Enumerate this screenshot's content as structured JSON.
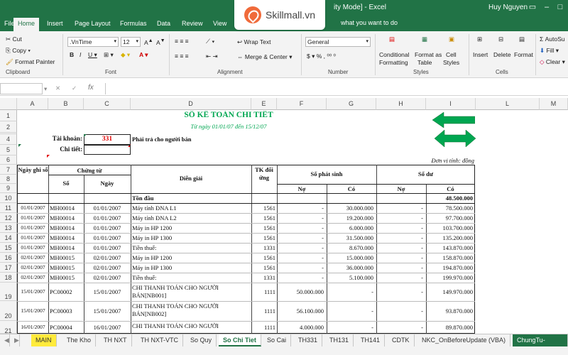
{
  "titlebar": {
    "doc_title": "ity Mode]  -  Excel",
    "user": "Huy Nguyen",
    "logo_text": "Skillmall.vn"
  },
  "tabs": [
    {
      "label": "File"
    },
    {
      "label": "Home"
    },
    {
      "label": "Insert"
    },
    {
      "label": "Page Layout"
    },
    {
      "label": "Formulas"
    },
    {
      "label": "Data"
    },
    {
      "label": "Review"
    },
    {
      "label": "View"
    }
  ],
  "tell_me": "what you want to do",
  "ribbon": {
    "clipboard": {
      "cut": "Cut",
      "copy": "Copy",
      "format_painter": "Format Painter",
      "label": "Clipboard"
    },
    "font": {
      "name": ".VnTime",
      "size": "12",
      "label": "Font"
    },
    "alignment": {
      "wrap": "Wrap Text",
      "merge": "Merge & Center",
      "label": "Alignment"
    },
    "number": {
      "format": "General",
      "label": "Number"
    },
    "styles": {
      "cond1": "Conditional",
      "cond2": "Formatting",
      "fmt1": "Format as",
      "fmt2": "Table",
      "cell1": "Cell",
      "cell2": "Styles",
      "label": "Styles"
    },
    "cells": {
      "insert": "Insert",
      "delete": "Delete",
      "format": "Format",
      "label": "Cells"
    },
    "editing": {
      "autosum": "AutoSu",
      "fill": "Fill",
      "clear": "Clear"
    }
  },
  "formula_bar": {
    "fx": "fx",
    "value": ""
  },
  "columns": [
    "A",
    "B",
    "C",
    "D",
    "E",
    "F",
    "G",
    "H",
    "I",
    "L",
    "M"
  ],
  "rows": [
    "1",
    "2",
    "3",
    "4",
    "5",
    "6",
    "7",
    "8",
    "9",
    "10",
    "11",
    "12",
    "13",
    "14",
    "15",
    "16",
    "17",
    "18",
    "19",
    "20",
    "21"
  ],
  "sheet": {
    "title": "SỔ KẾ TOÁN CHI TIẾT",
    "subtitle": "Từ ngày 01/01/07 đến 15/12/07",
    "account_label": "Tài khoản:",
    "account_value": "331",
    "account_desc": "Phải trả cho người bán",
    "detail_label": "Chi tiết:",
    "unit": "Đơn vị tính: đồng",
    "headers": {
      "date": "Ngày ghi sổ",
      "voucher": "Chứng từ",
      "no": "Số",
      "day": "Ngày",
      "desc": "Diễn giải",
      "tk": "TK đối ứng",
      "so_phat_sinh": "Số phát sinh",
      "so_du": "Số dư",
      "no_debit": "Nợ",
      "co_credit": "Có"
    },
    "opening": {
      "desc": "Tồn đầu",
      "balance": "48.500.000"
    },
    "rows": [
      {
        "row": "11",
        "date": "01/01/2007",
        "no": "MH00014",
        "day": "01/01/2007",
        "desc": "Máy tính ĐNA L1",
        "tk": "1561",
        "debit": "-",
        "credit": "30.000.000",
        "bal_debit": "-",
        "bal_credit": "78.500.000"
      },
      {
        "row": "12",
        "date": "01/01/2007",
        "no": "MH00014",
        "day": "01/01/2007",
        "desc": "Máy tính ĐNA L2",
        "tk": "1561",
        "debit": "-",
        "credit": "19.200.000",
        "bal_debit": "-",
        "bal_credit": "97.700.000"
      },
      {
        "row": "13",
        "date": "01/01/2007",
        "no": "MH00014",
        "day": "01/01/2007",
        "desc": "Máy in HP 1200",
        "tk": "1561",
        "debit": "-",
        "credit": "6.000.000",
        "bal_debit": "-",
        "bal_credit": "103.700.000"
      },
      {
        "row": "14",
        "date": "01/01/2007",
        "no": "MH00014",
        "day": "01/01/2007",
        "desc": "Máy in HP 1300",
        "tk": "1561",
        "debit": "-",
        "credit": "31.500.000",
        "bal_debit": "-",
        "bal_credit": "135.200.000"
      },
      {
        "row": "15",
        "date": "01/01/2007",
        "no": "MH00014",
        "day": "01/01/2007",
        "desc": "Tiền thuế:",
        "tk": "1331",
        "debit": "-",
        "credit": "8.670.000",
        "bal_debit": "-",
        "bal_credit": "143.870.000"
      },
      {
        "row": "16",
        "date": "02/01/2007",
        "no": "MH00015",
        "day": "02/01/2007",
        "desc": "Máy in HP 1200",
        "tk": "1561",
        "debit": "-",
        "credit": "15.000.000",
        "bal_debit": "-",
        "bal_credit": "158.870.000"
      },
      {
        "row": "17",
        "date": "02/01/2007",
        "no": "MH00015",
        "day": "02/01/2007",
        "desc": "Máy in HP 1300",
        "tk": "1561",
        "debit": "-",
        "credit": "36.000.000",
        "bal_debit": "-",
        "bal_credit": "194.870.000"
      },
      {
        "row": "18",
        "date": "02/01/2007",
        "no": "MH00015",
        "day": "02/01/2007",
        "desc": "Tiền thuế:",
        "tk": "1331",
        "debit": "-",
        "credit": "5.100.000",
        "bal_debit": "-",
        "bal_credit": "199.970.000"
      },
      {
        "row": "19",
        "date": "15/01/2007",
        "no": "PC00002",
        "day": "15/01/2007",
        "desc": "CHI THANH TOÁN CHO NGƯỜI",
        "desc2": "BÁN[NB001]",
        "tk": "1111",
        "debit": "50.000.000",
        "credit": "-",
        "bal_debit": "-",
        "bal_credit": "149.970.000"
      },
      {
        "row": "20",
        "date": "15/01/2007",
        "no": "PC00003",
        "day": "15/01/2007",
        "desc": "CHI THANH TOÁN CHO NGƯỜI",
        "desc2": "BÁN[NB002]",
        "tk": "1111",
        "debit": "56.100.000",
        "credit": "-",
        "bal_debit": "-",
        "bal_credit": "93.870.000"
      },
      {
        "row": "21",
        "date": "16/01/2007",
        "no": "PC00004",
        "day": "16/01/2007",
        "desc": "CHI THANH TOÁN CHO NGƯỜI",
        "desc2": "",
        "tk": "1111",
        "debit": "4.000.000",
        "credit": "-",
        "bal_debit": "-",
        "bal_credit": "89.870.000"
      }
    ]
  },
  "sheet_tabs": [
    {
      "label": "MAIN"
    },
    {
      "label": "The Kho"
    },
    {
      "label": "TH NXT"
    },
    {
      "label": "TH NXT-VTC"
    },
    {
      "label": "So Quy"
    },
    {
      "label": "So Chi Tiet"
    },
    {
      "label": "So Cai"
    },
    {
      "label": "TH331"
    },
    {
      "label": "TH131"
    },
    {
      "label": "TH141"
    },
    {
      "label": "CDTK"
    },
    {
      "label": "NKC_OnBeforeUpdate (VBA)"
    },
    {
      "label": "ChungTu-Header"
    }
  ],
  "colors": {
    "excel_green": "#217346",
    "title_green": "#00a651",
    "red": "#e00000"
  }
}
